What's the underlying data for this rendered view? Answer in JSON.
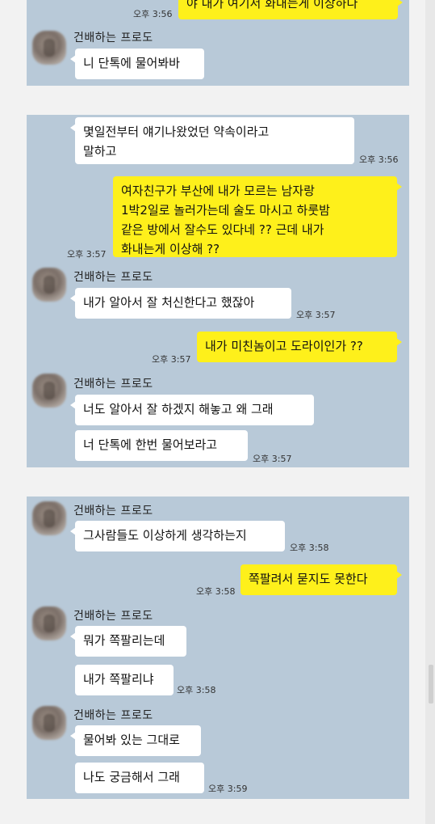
{
  "sender_name": "건배하는 프로도",
  "panel1": {
    "top_bubble": "야 내가 여기서 화내는게 이상하다",
    "top_time": "오후 3:56",
    "msg": "니 단톡에 물어봐바"
  },
  "panel2": {
    "msg1": "몇일전부터 얘기나왔었던 약속이라고\n말하고",
    "msg1_time": "오후 3:56",
    "out1": "여자친구가 부산에 내가 모르는 남자랑\n1박2일로 놀러가는데 술도 마시고 하룻밤\n같은 방에서 잘수도 있다네 ?? 근데 내가\n화내는게 이상해 ??",
    "out1_time": "오후 3:57",
    "msg2": "내가 알아서 잘 처신한다고 했잖아",
    "msg2_time": "오후 3:57",
    "out2": "내가 미친놈이고 도라이인가 ??",
    "out2_time": "오후 3:57",
    "msg3": "너도 알아서 잘 하겠지 해놓고 왜 그래",
    "msg4": "너 단톡에 한번 물어보라고",
    "msg4_time": "오후 3:57"
  },
  "panel3": {
    "msg1": "그사람들도 이상하게 생각하는지",
    "msg1_time": "오후 3:58",
    "out1": "쪽팔려서 묻지도 못한다",
    "out1_time": "오후 3:58",
    "msg2": "뭐가 쪽팔리는데",
    "msg3": "내가 쪽팔리냐",
    "msg3_time": "오후 3:58",
    "msg4": "물어봐 있는 그대로",
    "msg5": "나도 궁금해서 그래",
    "msg5_time": "오후 3:59"
  },
  "colors": {
    "chat_bg": "#b8c9d8",
    "incoming_bubble": "#ffffff",
    "outgoing_bubble": "#fef01b",
    "page_bg": "#f2f2f2"
  }
}
